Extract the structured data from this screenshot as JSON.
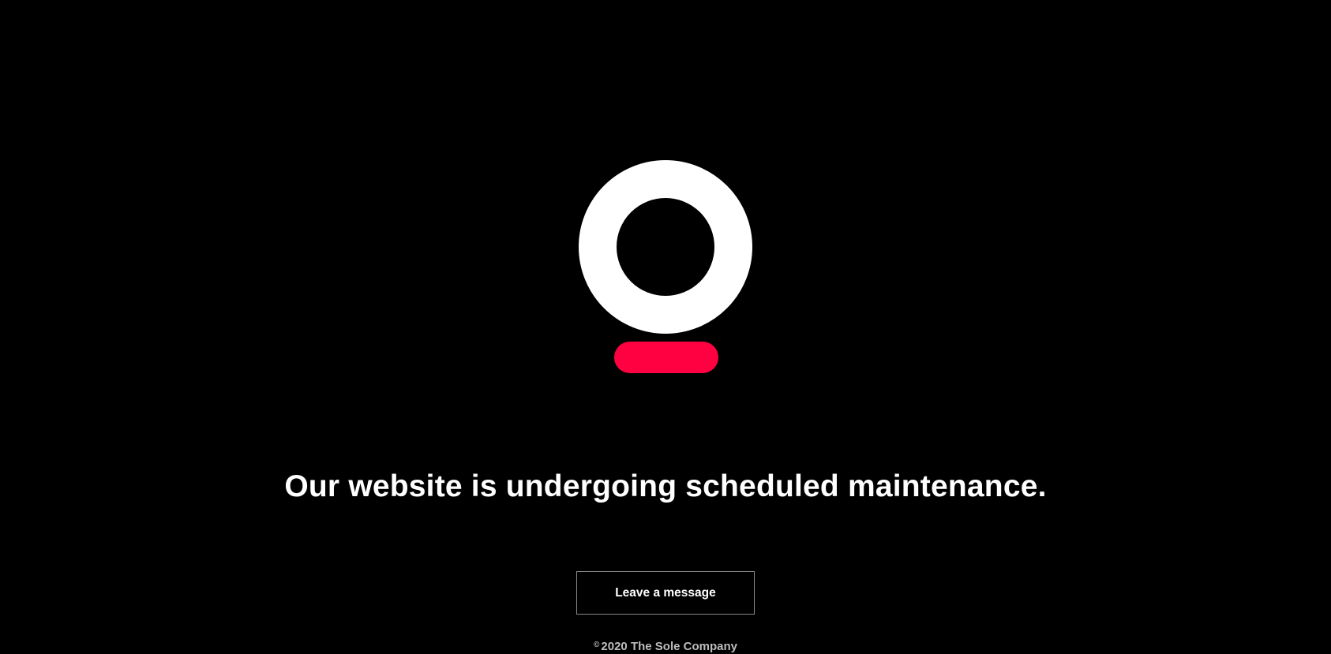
{
  "logo": {
    "icon": "sole-company-logo-icon",
    "ring_color": "#ffffff",
    "bar_color": "#ff0040",
    "background": "#000000"
  },
  "main": {
    "headline": "Our website is undergoing scheduled maintenance.",
    "cta_label": "Leave a message"
  },
  "footer": {
    "copyright_symbol": "©",
    "text": "2020 The Sole Company"
  }
}
